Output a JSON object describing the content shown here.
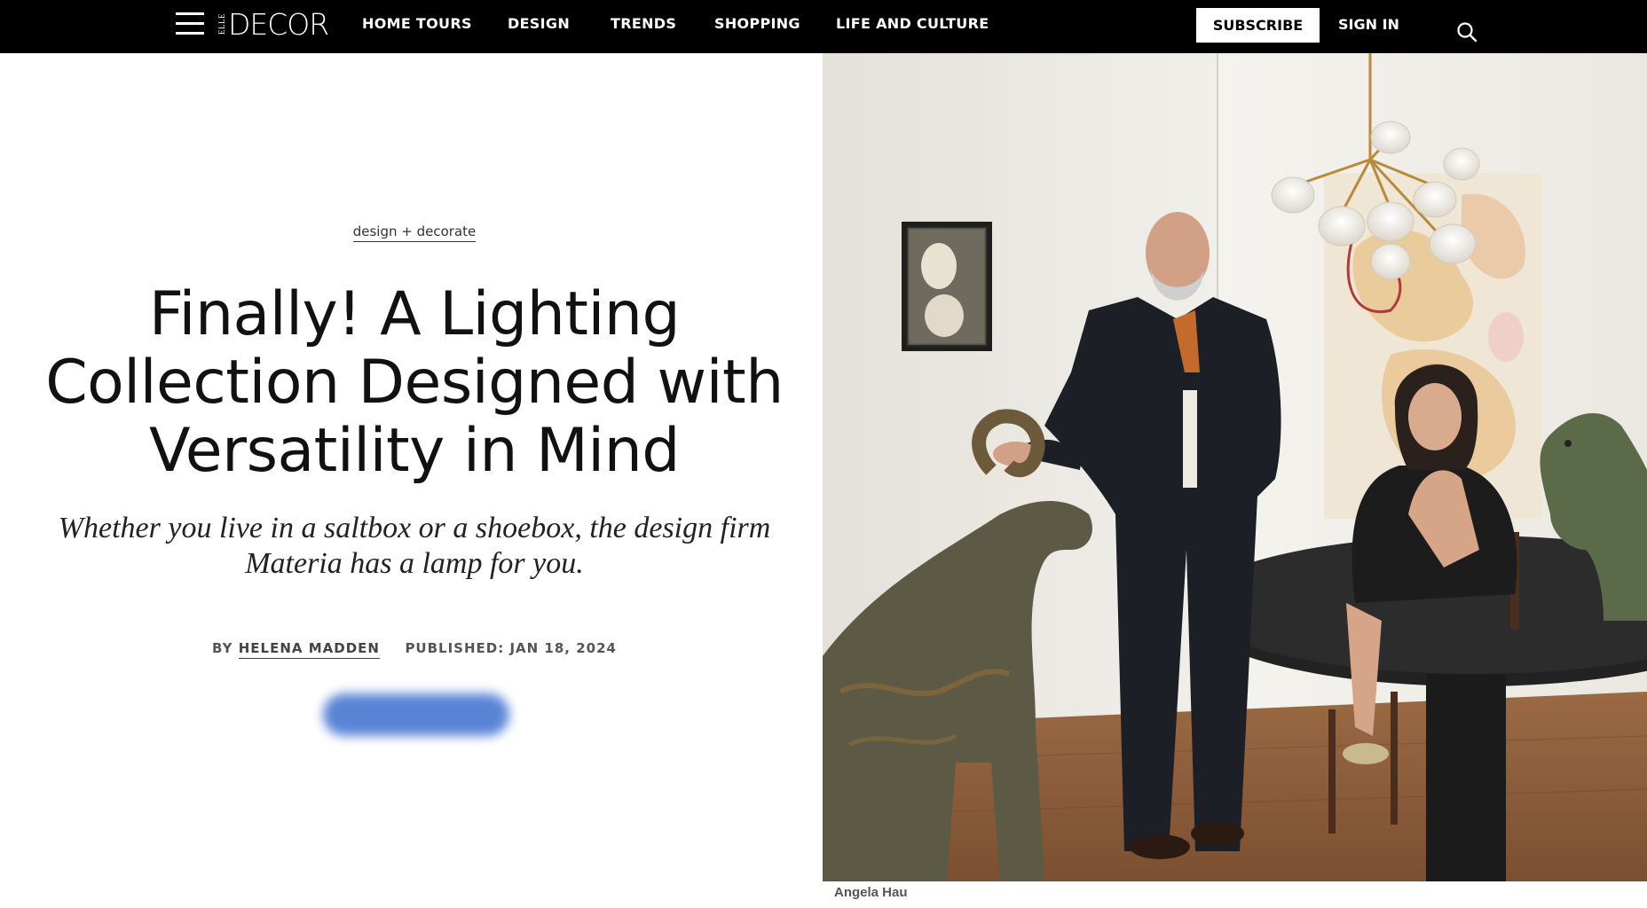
{
  "nav": {
    "logo_small": "ELLE",
    "logo_main": "DECOR",
    "links": [
      "HOME TOURS",
      "DESIGN",
      "TRENDS",
      "SHOPPING",
      "LIFE AND CULTURE"
    ],
    "subscribe_label": "SUBSCRIBE",
    "signin_label": "SIGN IN"
  },
  "article": {
    "category": "design + decorate",
    "headline_lines": [
      "Finally! A Lighting",
      "Collection Designed with",
      "Versatility in Mind"
    ],
    "dek": "Whether you live in a saltbox or a shoebox, the design firm Materia has a lamp for you.",
    "by_prefix": "BY",
    "author": "HELENA MADDEN",
    "published": "PUBLISHED: JAN 18, 2024"
  },
  "hero": {
    "photo_credit": "Angela Hau"
  },
  "colors": {
    "nav_bg": "#000000",
    "nav_text": "#ffffff",
    "blurred_button": "#3d6fd0"
  }
}
